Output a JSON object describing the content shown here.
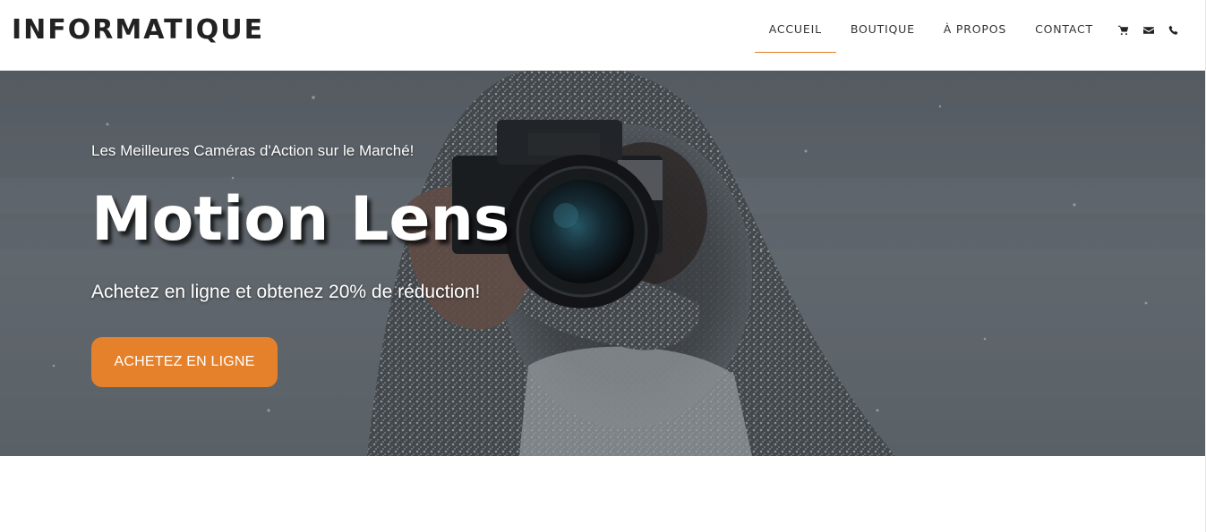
{
  "brand": {
    "name": "INFORMATIQUE"
  },
  "nav": {
    "items": [
      {
        "label": "ACCUEIL",
        "active": true
      },
      {
        "label": "BOUTIQUE",
        "active": false
      },
      {
        "label": "À PROPOS",
        "active": false
      },
      {
        "label": "CONTACT",
        "active": false
      }
    ],
    "icons": [
      "cart-icon",
      "envelope-icon",
      "phone-icon"
    ]
  },
  "hero": {
    "subtitle": "Les Meilleures Caméras d'Action sur le Marché!",
    "title": "Motion Lens",
    "tagline": "Achetez en ligne et obtenez 20% de réduction!",
    "button_label": "ACHETEZ EN LIGNE"
  },
  "colors": {
    "accent": "#e6812b",
    "nav_underline": "#e67e22",
    "text_dark": "#222222"
  }
}
